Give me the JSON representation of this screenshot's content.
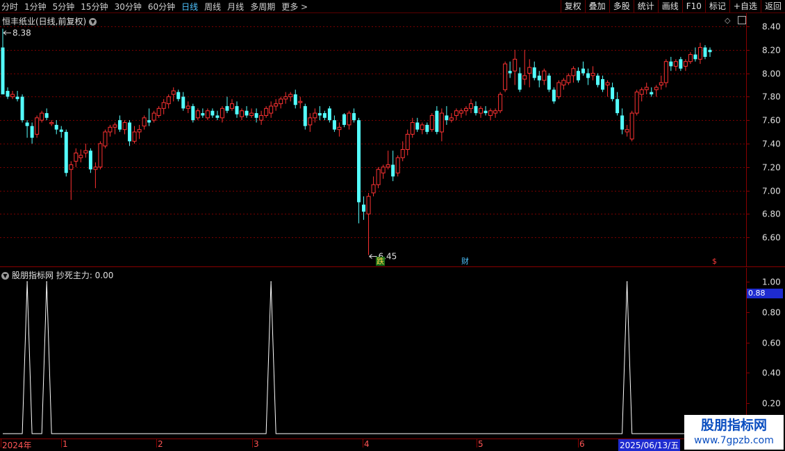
{
  "toolbar": {
    "periods": [
      "分时",
      "1分钟",
      "5分钟",
      "15分钟",
      "30分钟",
      "60分钟",
      "日线",
      "周线",
      "月线",
      "多周期",
      "更多 >"
    ],
    "active_period": "日线",
    "tools": [
      "复权",
      "叠加",
      "多股",
      "统计",
      "画线",
      "F10",
      "标记",
      "+自选",
      "返回"
    ]
  },
  "price_panel": {
    "title": "恒丰纸业(日线,前复权)",
    "high_label": "8.38",
    "low_label": "6.45",
    "axis_ticks": [
      "8.40",
      "8.20",
      "8.00",
      "7.80",
      "7.60",
      "7.40",
      "7.20",
      "7.00",
      "6.80",
      "6.60"
    ],
    "markers": [
      {
        "text": "跌",
        "color": "#ffd24a",
        "bg": "#1a6e1a"
      },
      {
        "text": "财",
        "color": "#4fc3ff",
        "bg": "#000000"
      },
      {
        "text": "$",
        "color": "#ff3b3b",
        "bg": "#000000"
      }
    ]
  },
  "indicator_panel": {
    "title": "股朋指标网 抄死主力: 0.00",
    "axis_ticks": [
      "1.00",
      "0.80",
      "0.60",
      "0.40",
      "0.20"
    ],
    "current_value": "0.88"
  },
  "date_axis": {
    "labels": [
      "2024年",
      "1",
      "2",
      "3",
      "4",
      "5",
      "6"
    ],
    "cursor_date": "2025/06/13/五"
  },
  "watermark": {
    "line1": "股朋指标网",
    "line2": "www.7gpzb.com"
  },
  "colors": {
    "up": "#ff3232",
    "down": "#54ffff",
    "grid": "#7a0000",
    "axis": "#8a0000"
  },
  "chart_data": {
    "type": "candlestick",
    "ylim": [
      6.45,
      8.45
    ],
    "candles": [
      [
        8.22,
        8.38,
        8.22,
        7.82
      ],
      [
        7.85,
        7.88,
        7.78,
        7.8
      ],
      [
        7.8,
        7.85,
        7.78,
        7.82
      ],
      [
        7.8,
        7.85,
        7.76,
        7.78
      ],
      [
        7.8,
        7.82,
        7.58,
        7.6
      ],
      [
        7.58,
        7.6,
        7.45,
        7.55
      ],
      [
        7.55,
        7.58,
        7.4,
        7.45
      ],
      [
        7.48,
        7.64,
        7.45,
        7.62
      ],
      [
        7.6,
        7.68,
        7.58,
        7.66
      ],
      [
        7.66,
        7.7,
        7.6,
        7.62
      ],
      [
        7.57,
        7.6,
        7.55,
        7.58
      ],
      [
        7.56,
        7.6,
        7.48,
        7.52
      ],
      [
        7.52,
        7.55,
        7.45,
        7.5
      ],
      [
        7.5,
        7.52,
        7.12,
        7.15
      ],
      [
        7.18,
        7.25,
        6.92,
        7.22
      ],
      [
        7.25,
        7.36,
        7.2,
        7.32
      ],
      [
        7.28,
        7.35,
        7.24,
        7.3
      ],
      [
        7.32,
        7.4,
        7.28,
        7.34
      ],
      [
        7.34,
        7.36,
        7.15,
        7.18
      ],
      [
        7.18,
        7.24,
        7.02,
        7.2
      ],
      [
        7.2,
        7.42,
        7.18,
        7.4
      ],
      [
        7.38,
        7.52,
        7.36,
        7.5
      ],
      [
        7.5,
        7.56,
        7.46,
        7.54
      ],
      [
        7.54,
        7.58,
        7.48,
        7.56
      ],
      [
        7.6,
        7.64,
        7.5,
        7.52
      ],
      [
        7.52,
        7.6,
        7.48,
        7.58
      ],
      [
        7.58,
        7.6,
        7.38,
        7.42
      ],
      [
        7.42,
        7.55,
        7.4,
        7.5
      ],
      [
        7.5,
        7.56,
        7.44,
        7.52
      ],
      [
        7.55,
        7.64,
        7.52,
        7.62
      ],
      [
        7.6,
        7.7,
        7.55,
        7.58
      ],
      [
        7.6,
        7.68,
        7.58,
        7.66
      ],
      [
        7.64,
        7.72,
        7.62,
        7.7
      ],
      [
        7.7,
        7.78,
        7.65,
        7.75
      ],
      [
        7.74,
        7.82,
        7.7,
        7.8
      ],
      [
        7.82,
        7.88,
        7.76,
        7.85
      ],
      [
        7.84,
        7.86,
        7.76,
        7.78
      ],
      [
        7.8,
        7.84,
        7.68,
        7.7
      ],
      [
        7.7,
        7.76,
        7.66,
        7.72
      ],
      [
        7.72,
        7.74,
        7.58,
        7.6
      ],
      [
        7.62,
        7.7,
        7.6,
        7.68
      ],
      [
        7.66,
        7.7,
        7.62,
        7.64
      ],
      [
        7.62,
        7.7,
        7.6,
        7.68
      ],
      [
        7.68,
        7.7,
        7.62,
        7.64
      ],
      [
        7.64,
        7.68,
        7.6,
        7.62
      ],
      [
        7.62,
        7.72,
        7.58,
        7.7
      ],
      [
        7.72,
        7.8,
        7.66,
        7.68
      ],
      [
        7.7,
        7.78,
        7.68,
        7.74
      ],
      [
        7.72,
        7.76,
        7.62,
        7.65
      ],
      [
        7.63,
        7.7,
        7.6,
        7.68
      ],
      [
        7.68,
        7.72,
        7.62,
        7.64
      ],
      [
        7.64,
        7.7,
        7.62,
        7.66
      ],
      [
        7.66,
        7.7,
        7.58,
        7.62
      ],
      [
        7.6,
        7.68,
        7.56,
        7.64
      ],
      [
        7.64,
        7.72,
        7.62,
        7.7
      ],
      [
        7.66,
        7.76,
        7.62,
        7.72
      ],
      [
        7.72,
        7.78,
        7.68,
        7.74
      ],
      [
        7.74,
        7.8,
        7.7,
        7.78
      ],
      [
        7.78,
        7.84,
        7.74,
        7.8
      ],
      [
        7.8,
        7.84,
        7.76,
        7.82
      ],
      [
        7.82,
        7.86,
        7.7,
        7.73
      ],
      [
        7.75,
        7.8,
        7.7,
        7.76
      ],
      [
        7.72,
        7.74,
        7.52,
        7.55
      ],
      [
        7.56,
        7.66,
        7.5,
        7.62
      ],
      [
        7.62,
        7.7,
        7.58,
        7.66
      ],
      [
        7.66,
        7.72,
        7.6,
        7.64
      ],
      [
        7.66,
        7.68,
        7.6,
        7.62
      ],
      [
        7.7,
        7.72,
        7.58,
        7.6
      ],
      [
        7.6,
        7.64,
        7.5,
        7.52
      ],
      [
        7.52,
        7.58,
        7.46,
        7.54
      ],
      [
        7.65,
        7.66,
        7.54,
        7.56
      ],
      [
        7.56,
        7.68,
        7.52,
        7.66
      ],
      [
        7.66,
        7.7,
        7.58,
        7.6
      ],
      [
        7.6,
        7.62,
        6.72,
        6.9
      ],
      [
        6.88,
        6.95,
        6.75,
        6.82
      ],
      [
        6.8,
        6.98,
        6.45,
        6.95
      ],
      [
        6.98,
        7.12,
        6.95,
        7.05
      ],
      [
        7.05,
        7.2,
        7.02,
        7.18
      ],
      [
        7.15,
        7.22,
        7.1,
        7.2
      ],
      [
        7.2,
        7.34,
        7.18,
        7.22
      ],
      [
        7.22,
        7.34,
        7.08,
        7.12
      ],
      [
        7.15,
        7.3,
        7.12,
        7.28
      ],
      [
        7.28,
        7.42,
        7.25,
        7.35
      ],
      [
        7.35,
        7.52,
        7.3,
        7.48
      ],
      [
        7.48,
        7.62,
        7.45,
        7.58
      ],
      [
        7.58,
        7.62,
        7.5,
        7.52
      ],
      [
        7.52,
        7.58,
        7.48,
        7.56
      ],
      [
        7.56,
        7.58,
        7.48,
        7.5
      ],
      [
        7.52,
        7.66,
        7.5,
        7.64
      ],
      [
        7.68,
        7.72,
        7.48,
        7.5
      ],
      [
        7.5,
        7.7,
        7.42,
        7.66
      ],
      [
        7.64,
        7.72,
        7.56,
        7.6
      ],
      [
        7.6,
        7.66,
        7.58,
        7.62
      ],
      [
        7.64,
        7.7,
        7.6,
        7.68
      ],
      [
        7.66,
        7.7,
        7.62,
        7.68
      ],
      [
        7.68,
        7.72,
        7.64,
        7.7
      ],
      [
        7.7,
        7.78,
        7.66,
        7.74
      ],
      [
        7.72,
        7.76,
        7.64,
        7.66
      ],
      [
        7.66,
        7.72,
        7.62,
        7.7
      ],
      [
        7.68,
        7.72,
        7.64,
        7.66
      ],
      [
        7.64,
        7.7,
        7.6,
        7.68
      ],
      [
        7.66,
        7.7,
        7.62,
        7.68
      ],
      [
        7.68,
        7.84,
        7.66,
        7.82
      ],
      [
        7.86,
        8.1,
        7.84,
        8.08
      ],
      [
        8.02,
        8.1,
        7.96,
        8.0
      ],
      [
        8.02,
        8.2,
        7.9,
        8.12
      ],
      [
        8.0,
        8.05,
        7.84,
        7.86
      ],
      [
        7.95,
        8.2,
        7.9,
        7.98
      ],
      [
        8.0,
        8.12,
        7.88,
        8.05
      ],
      [
        8.05,
        8.1,
        7.94,
        7.96
      ],
      [
        7.98,
        8.02,
        7.88,
        7.94
      ],
      [
        7.94,
        8.04,
        7.9,
        8.02
      ],
      [
        7.98,
        8.0,
        7.84,
        7.86
      ],
      [
        7.86,
        7.88,
        7.74,
        7.76
      ],
      [
        7.8,
        7.94,
        7.78,
        7.92
      ],
      [
        7.9,
        7.96,
        7.86,
        7.94
      ],
      [
        7.92,
        8.0,
        7.9,
        7.98
      ],
      [
        7.98,
        8.06,
        7.92,
        8.04
      ],
      [
        8.02,
        8.05,
        7.92,
        7.94
      ],
      [
        8.04,
        8.1,
        7.98,
        8.0
      ],
      [
        8.0,
        8.04,
        7.9,
        7.96
      ],
      [
        7.98,
        8.06,
        7.94,
        8.0
      ],
      [
        7.98,
        8.0,
        7.88,
        7.9
      ],
      [
        7.95,
        7.98,
        7.84,
        7.86
      ],
      [
        7.9,
        7.94,
        7.8,
        7.92
      ],
      [
        7.88,
        7.92,
        7.76,
        7.78
      ],
      [
        7.78,
        7.84,
        7.64,
        7.66
      ],
      [
        7.64,
        7.7,
        7.48,
        7.52
      ],
      [
        7.5,
        7.56,
        7.46,
        7.52
      ],
      [
        7.44,
        7.68,
        7.42,
        7.66
      ],
      [
        7.66,
        7.86,
        7.64,
        7.84
      ],
      [
        7.82,
        7.88,
        7.76,
        7.86
      ],
      [
        7.86,
        7.92,
        7.82,
        7.88
      ],
      [
        7.84,
        7.88,
        7.8,
        7.82
      ],
      [
        7.86,
        7.9,
        7.8,
        7.88
      ],
      [
        7.9,
        7.98,
        7.86,
        7.92
      ],
      [
        7.92,
        8.12,
        7.88,
        8.1
      ],
      [
        8.1,
        8.14,
        8.02,
        8.06
      ],
      [
        8.06,
        8.12,
        8.02,
        8.1
      ],
      [
        8.12,
        8.14,
        8.02,
        8.04
      ],
      [
        8.06,
        8.12,
        8.02,
        8.1
      ],
      [
        8.1,
        8.18,
        8.08,
        8.16
      ],
      [
        8.16,
        8.22,
        8.1,
        8.12
      ],
      [
        8.12,
        8.26,
        8.08,
        8.22
      ],
      [
        8.22,
        8.24,
        8.12,
        8.14
      ],
      [
        8.2,
        8.22,
        8.14,
        8.18
      ]
    ],
    "indicator": {
      "name": "抄死主力",
      "ylim": [
        0,
        1
      ],
      "spikes": [
        {
          "value": 1.0,
          "bar": 5
        },
        {
          "value": 1.0,
          "bar": 9
        },
        {
          "value": 1.0,
          "bar": 55
        },
        {
          "value": 1.0,
          "bar": 128
        }
      ]
    }
  }
}
